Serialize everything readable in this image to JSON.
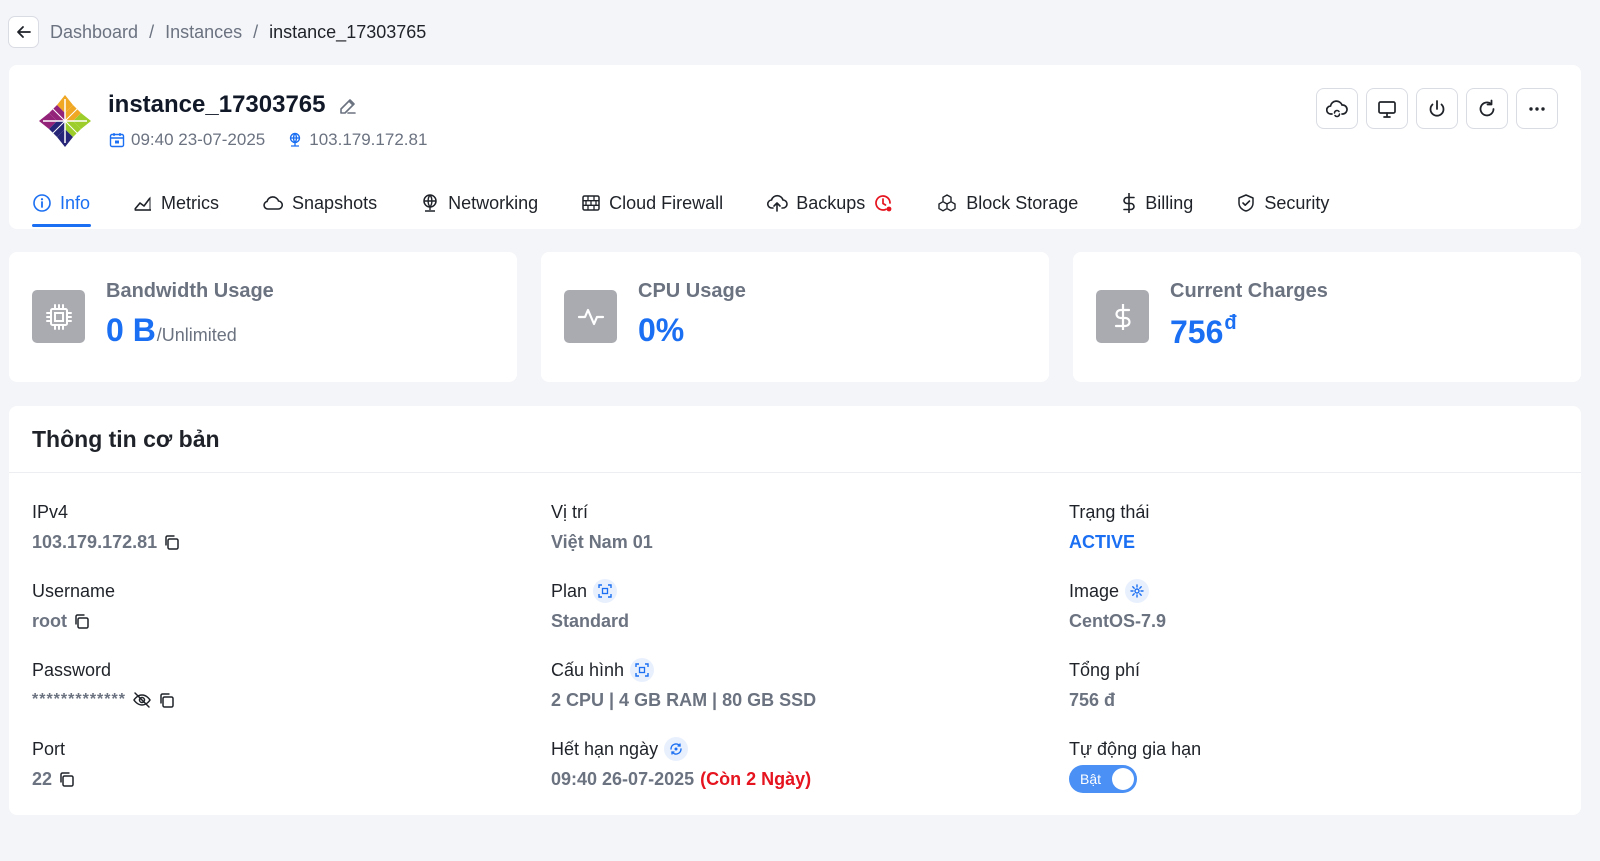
{
  "breadcrumb": {
    "items": [
      "Dashboard",
      "Instances",
      "instance_17303765"
    ]
  },
  "instance": {
    "name": "instance_17303765",
    "created": "09:40 23-07-2025",
    "ip": "103.179.172.81",
    "logo": "centos-logo"
  },
  "actions": [
    "cloud-sync-icon",
    "monitor-icon",
    "power-icon",
    "refresh-icon",
    "more-icon"
  ],
  "tabs": [
    {
      "label": "Info",
      "icon": "info-icon",
      "active": true
    },
    {
      "label": "Metrics",
      "icon": "chart-icon"
    },
    {
      "label": "Snapshots",
      "icon": "cloud-icon"
    },
    {
      "label": "Networking",
      "icon": "network-icon"
    },
    {
      "label": "Cloud Firewall",
      "icon": "firewall-icon"
    },
    {
      "label": "Backups",
      "icon": "upload-cloud-icon",
      "badge": "clock-alert-icon"
    },
    {
      "label": "Block Storage",
      "icon": "boxes-icon"
    },
    {
      "label": "Billing",
      "icon": "dollar-icon"
    },
    {
      "label": "Security",
      "icon": "shield-icon"
    }
  ],
  "stats": {
    "bandwidth": {
      "label": "Bandwidth Usage",
      "value": "0 B",
      "sub": "/Unlimited"
    },
    "cpu": {
      "label": "CPU Usage",
      "value": "0%"
    },
    "charges": {
      "label": "Current Charges",
      "value": "756",
      "currency": "đ"
    }
  },
  "info": {
    "title": "Thông tin cơ bản",
    "ipv4": {
      "label": "IPv4",
      "value": "103.179.172.81"
    },
    "username": {
      "label": "Username",
      "value": "root"
    },
    "password": {
      "label": "Password",
      "value": "*************"
    },
    "port": {
      "label": "Port",
      "value": "22"
    },
    "location": {
      "label": "Vị trí",
      "value": "Việt Nam 01"
    },
    "plan": {
      "label": "Plan",
      "value": "Standard"
    },
    "config": {
      "label": "Cấu hình",
      "value": "2 CPU | 4 GB RAM | 80 GB SSD"
    },
    "expiry": {
      "label": "Hết hạn ngày",
      "value": "09:40 26-07-2025",
      "remain_prefix": "(Còn ",
      "remain_days": "2",
      "remain_suffix": " Ngày)"
    },
    "status": {
      "label": "Trạng thái",
      "value": "ACTIVE"
    },
    "image": {
      "label": "Image",
      "value": "CentOS-7.9"
    },
    "total_fee": {
      "label": "Tổng phí",
      "value": "756 đ"
    },
    "auto_renew": {
      "label": "Tự động gia hạn",
      "toggle_label": "Bật",
      "on": true
    }
  },
  "colors": {
    "accent": "#1b6ff2",
    "danger": "#e5141f",
    "muted": "#6b7280",
    "background": "#f4f5f9"
  }
}
